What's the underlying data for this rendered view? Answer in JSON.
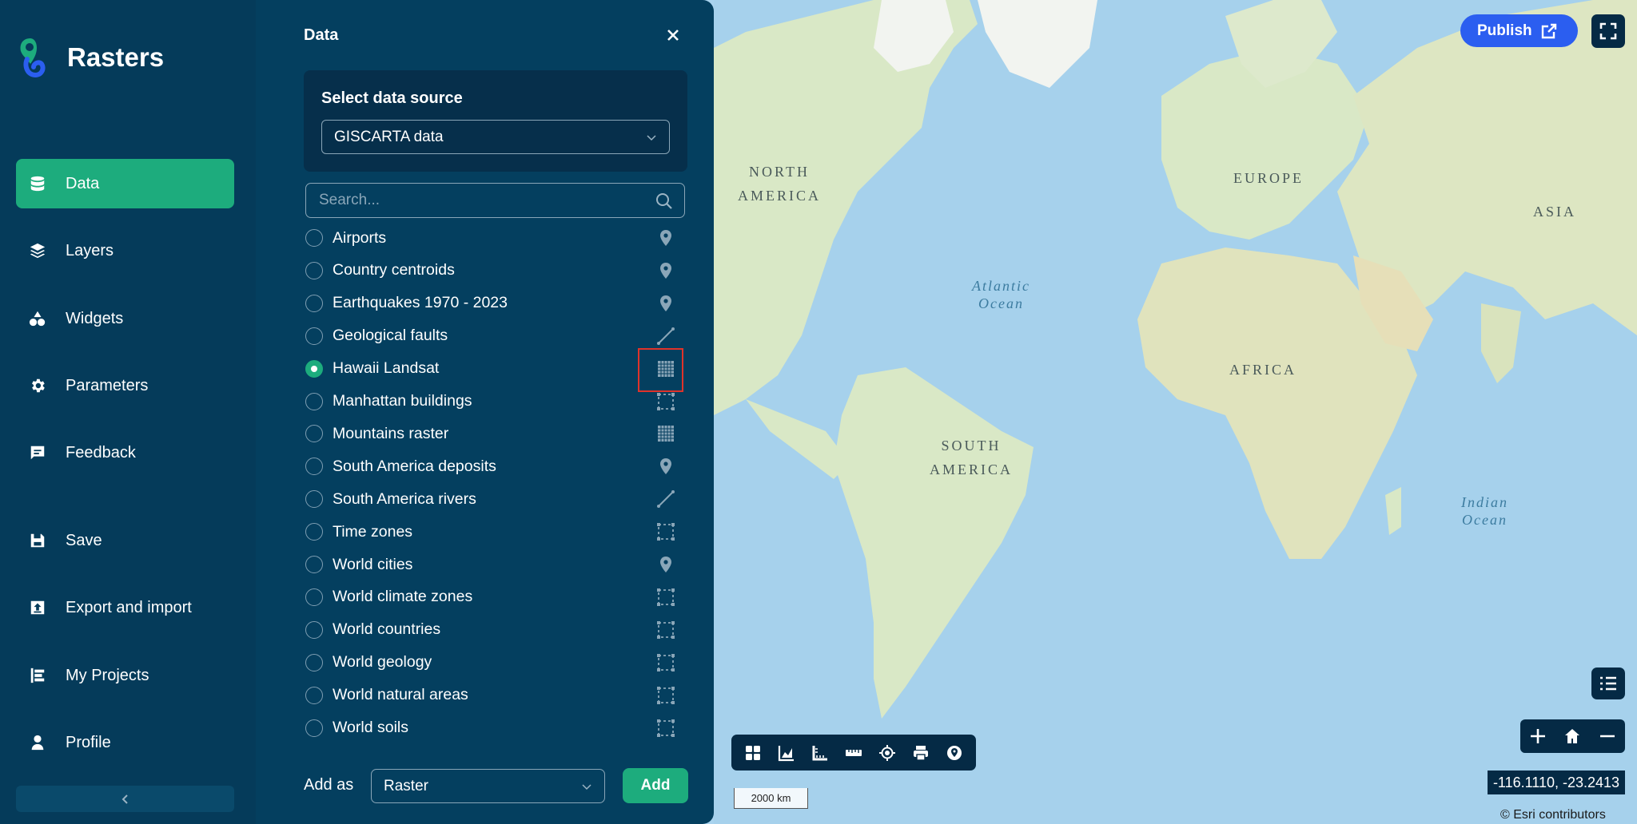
{
  "app": {
    "name": "Rasters"
  },
  "sidebar": {
    "items": [
      {
        "label": "Data",
        "icon": "database-icon",
        "active": true
      },
      {
        "label": "Layers",
        "icon": "layers-icon"
      },
      {
        "label": "Widgets",
        "icon": "widgets-icon"
      },
      {
        "label": "Parameters",
        "icon": "gear-icon"
      },
      {
        "label": "Feedback",
        "icon": "feedback-icon"
      },
      {
        "label": "Save",
        "icon": "save-icon"
      },
      {
        "label": "Export and import",
        "icon": "export-icon"
      },
      {
        "label": "My Projects",
        "icon": "projects-icon"
      },
      {
        "label": "Profile",
        "icon": "user-icon"
      }
    ]
  },
  "panel": {
    "title": "Data",
    "source_label": "Select data source",
    "source_value": "GISCARTA data",
    "search_placeholder": "Search...",
    "datasets": [
      {
        "name": "Airports",
        "type": "point",
        "checked": false
      },
      {
        "name": "Country centroids",
        "type": "point",
        "checked": false
      },
      {
        "name": "Earthquakes 1970 - 2023",
        "type": "point",
        "checked": false
      },
      {
        "name": "Geological faults",
        "type": "line",
        "checked": false
      },
      {
        "name": "Hawaii Landsat",
        "type": "raster",
        "checked": true
      },
      {
        "name": "Manhattan buildings",
        "type": "polygon",
        "checked": false
      },
      {
        "name": "Mountains raster",
        "type": "raster",
        "checked": false
      },
      {
        "name": "South America deposits",
        "type": "point",
        "checked": false
      },
      {
        "name": "South America rivers",
        "type": "line",
        "checked": false
      },
      {
        "name": "Time zones",
        "type": "polygon",
        "checked": false
      },
      {
        "name": "World cities",
        "type": "point",
        "checked": false
      },
      {
        "name": "World climate zones",
        "type": "polygon",
        "checked": false
      },
      {
        "name": "World countries",
        "type": "polygon",
        "checked": false
      },
      {
        "name": "World geology",
        "type": "polygon",
        "checked": false
      },
      {
        "name": "World natural areas",
        "type": "polygon",
        "checked": false
      },
      {
        "name": "World soils",
        "type": "polygon",
        "checked": false
      }
    ],
    "add_as_label": "Add as",
    "add_as_value": "Raster",
    "add_button": "Add"
  },
  "map": {
    "labels": {
      "north_america": "NORTH\nAMERICA",
      "south_america": "SOUTH\nAMERICA",
      "europe": "EUROPE",
      "africa": "AFRICA",
      "asia": "ASIA",
      "atlantic": "Atlantic\nOcean",
      "indian": "Indian\nOcean"
    },
    "publish_label": "Publish",
    "coords": "-116.1110, -23.2413",
    "attribution": "© Esri contributors",
    "scale": "2000 km",
    "colors": {
      "water": "#a6d1ec",
      "land": "#d9e8c6",
      "accent": "#1dac7d",
      "publish": "#2b5ef0"
    }
  }
}
